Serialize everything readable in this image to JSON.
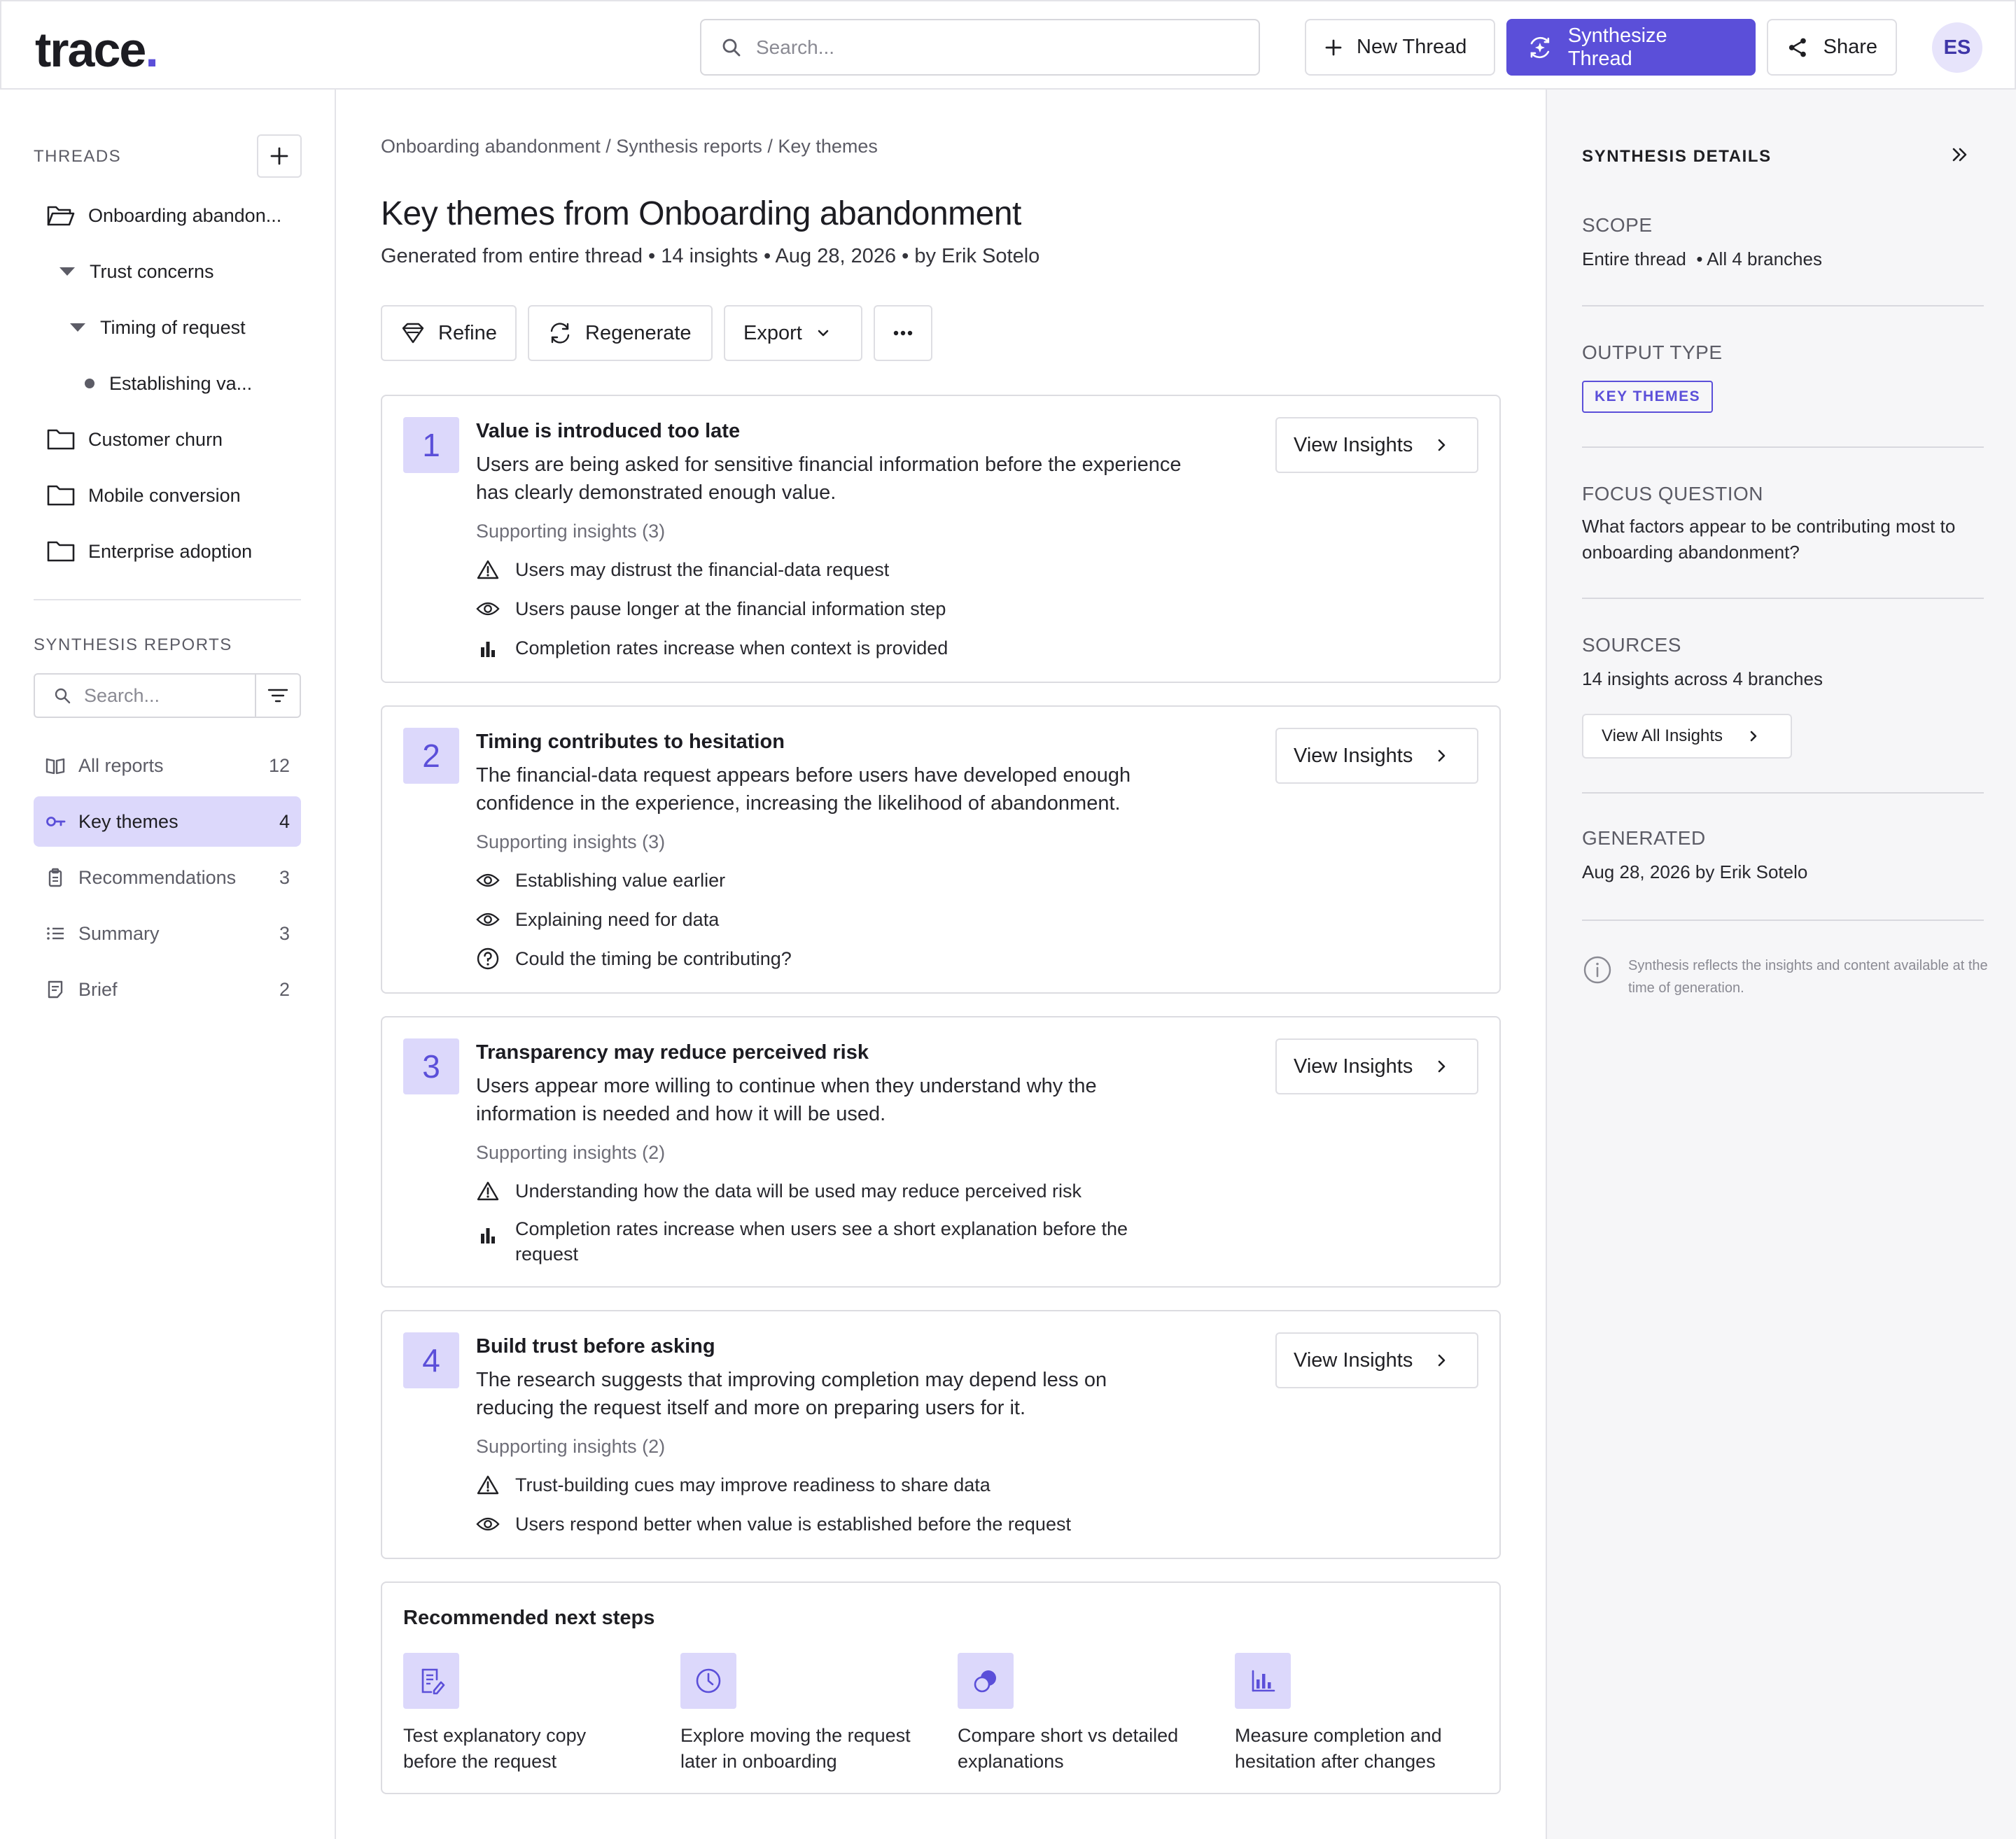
{
  "app": {
    "logo": "trace",
    "logo_dot": "."
  },
  "header": {
    "search_placeholder": "Search...",
    "new_thread_label": "New Thread",
    "synthesize_label": "Synthesize Thread",
    "share_label": "Share",
    "avatar_initials": "ES",
    "accent_color": "#5b4fd9"
  },
  "sidebar": {
    "threads_label": "THREADS",
    "threads": [
      {
        "label": "Onboarding abandon...",
        "icon": "folder-open-icon"
      },
      {
        "label": "Trust concerns",
        "icon": "caret-down-icon"
      },
      {
        "label": "Timing of request",
        "icon": "caret-down-icon"
      },
      {
        "label": "Establishing va...",
        "icon": "bullet-icon"
      },
      {
        "label": "Customer churn",
        "icon": "folder-icon"
      },
      {
        "label": "Mobile conversion",
        "icon": "folder-icon"
      },
      {
        "label": "Enterprise adoption",
        "icon": "folder-icon"
      }
    ],
    "reports_label": "SYNTHESIS REPORTS",
    "reports_search_placeholder": "Search...",
    "reports": [
      {
        "label": "All reports",
        "count": "12",
        "icon": "book-icon"
      },
      {
        "label": "Key themes",
        "count": "4",
        "icon": "key-icon",
        "active": true
      },
      {
        "label": "Recommendations",
        "count": "3",
        "icon": "clipboard-icon"
      },
      {
        "label": "Summary",
        "count": "3",
        "icon": "list-icon"
      },
      {
        "label": "Brief",
        "count": "2",
        "icon": "document-icon"
      }
    ]
  },
  "main": {
    "breadcrumb": "Onboarding abandonment / Synthesis reports / Key themes",
    "title": "Key themes from Onboarding abandonment",
    "meta": "Generated from entire thread • 14 insights • Aug 28, 2026 • by Erik Sotelo",
    "actions": {
      "refine": "Refine",
      "regenerate": "Regenerate",
      "export": "Export"
    },
    "view_insights_label": "View Insights",
    "themes": [
      {
        "number": "1",
        "title": "Value is introduced too late",
        "description": "Users are being asked for sensitive financial information before the experience has clearly demonstrated enough value.",
        "supporting_label": "Supporting insights (3)",
        "insights": [
          {
            "icon": "warning-icon",
            "text": "Users may distrust the financial-data request"
          },
          {
            "icon": "eye-icon",
            "text": "Users pause longer at the financial information step"
          },
          {
            "icon": "bar-chart-icon",
            "text": "Completion rates increase when context is provided"
          }
        ]
      },
      {
        "number": "2",
        "title": "Timing contributes to hesitation",
        "description": "The financial-data request appears before users have developed enough confidence in the experience, increasing the likelihood of abandonment.",
        "supporting_label": "Supporting insights (3)",
        "insights": [
          {
            "icon": "eye-icon",
            "text": "Establishing value earlier"
          },
          {
            "icon": "eye-icon",
            "text": "Explaining need for data"
          },
          {
            "icon": "question-icon",
            "text": "Could the timing be contributing?"
          }
        ]
      },
      {
        "number": "3",
        "title": "Transparency may reduce perceived risk",
        "description": "Users appear more willing to continue when they understand why the information is needed and how it will be used.",
        "supporting_label": "Supporting insights (2)",
        "insights": [
          {
            "icon": "warning-icon",
            "text": "Understanding how the data will be used may reduce perceived risk"
          },
          {
            "icon": "bar-chart-icon",
            "text": "Completion rates increase when users see a short explanation before the request"
          }
        ]
      },
      {
        "number": "4",
        "title": "Build trust before asking",
        "description": "The research suggests that improving completion may depend less on reducing the request itself and more on preparing users for it.",
        "supporting_label": "Supporting insights (2)",
        "insights": [
          {
            "icon": "warning-icon",
            "text": "Trust-building cues may improve readiness to share data"
          },
          {
            "icon": "eye-icon",
            "text": "Users respond better when value is established before the request"
          }
        ]
      }
    ],
    "next_steps": {
      "title": "Recommended next steps",
      "steps": [
        {
          "icon": "edit-document-icon",
          "text": "Test explanatory copy before the request"
        },
        {
          "icon": "clock-icon",
          "text": "Explore moving the request later in onboarding"
        },
        {
          "icon": "compare-circles-icon",
          "text": "Compare short vs detailed explanations"
        },
        {
          "icon": "bar-chart-icon",
          "text": "Measure completion and hesitation after changes"
        }
      ]
    }
  },
  "details": {
    "heading": "SYNTHESIS DETAILS",
    "scope_label": "SCOPE",
    "scope_value": "Entire thread  • All 4 branches",
    "output_type_label": "OUTPUT TYPE",
    "output_type_badge": "KEY THEMES",
    "focus_label": "FOCUS QUESTION",
    "focus_value": "What factors appear to be contributing most to onboarding abandonment?",
    "sources_label": "SOURCES",
    "sources_value": "14 insights across 4 branches",
    "view_all_label": "View All Insights",
    "generated_label": "GENERATED",
    "generated_value": "Aug 28, 2026 by Erik Sotelo",
    "note": "Synthesis reflects the insights and content available at the time of generation."
  }
}
